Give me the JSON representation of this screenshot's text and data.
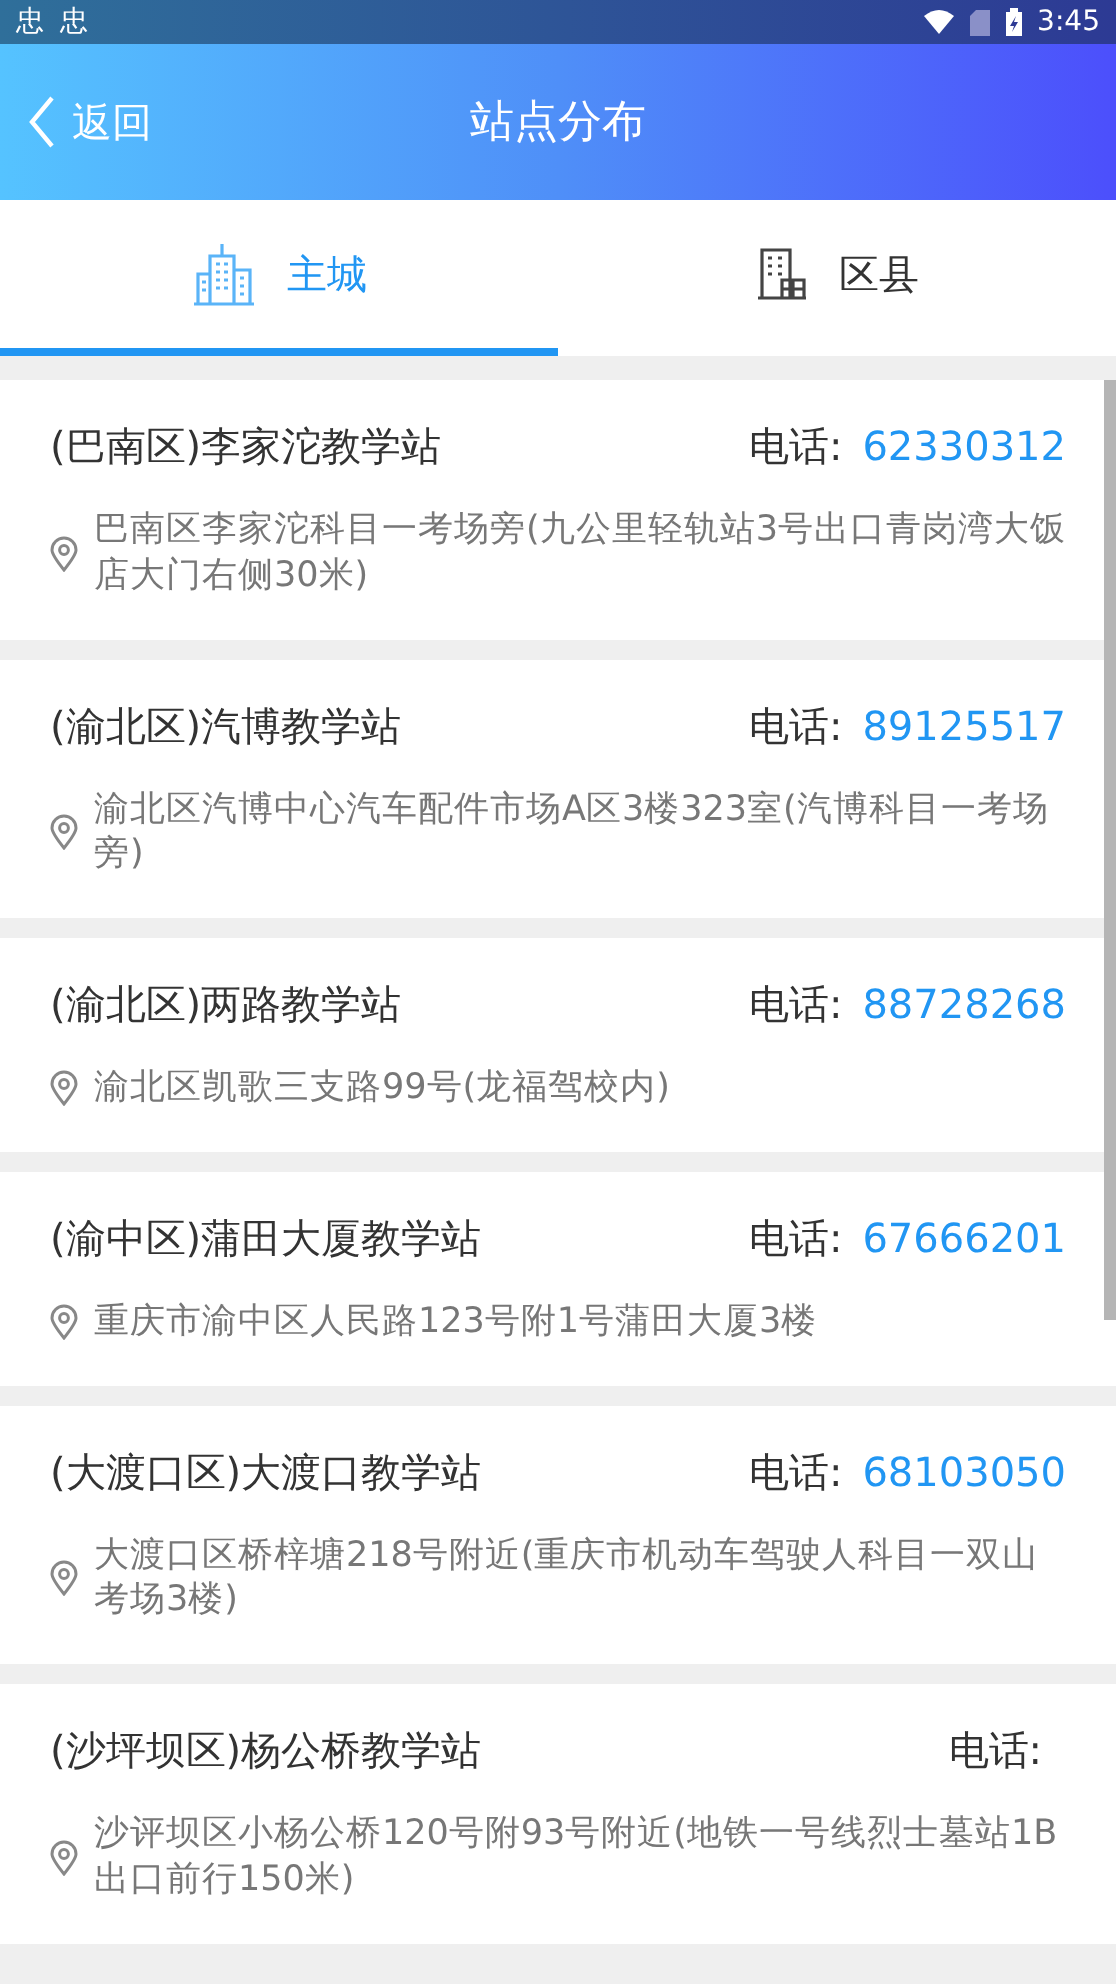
{
  "status_bar": {
    "notifications": [
      "忠",
      "忠"
    ],
    "time": "3:45"
  },
  "header": {
    "back": "返回",
    "title": "站点分布"
  },
  "tabs": [
    {
      "label": "主城",
      "kind": "city",
      "selected": true
    },
    {
      "label": "区县",
      "kind": "county",
      "selected": false
    }
  ],
  "stations": [
    {
      "name": "(巴南区)李家沱教学站",
      "phone_label": "电话:",
      "phone": "62330312",
      "address": "巴南区李家沱科目一考场旁(九公里轻轨站3号出口青岗湾大饭店大门右侧30米)"
    },
    {
      "name": "(渝北区)汽博教学站",
      "phone_label": "电话:",
      "phone": "89125517",
      "address": "渝北区汽博中心汽车配件市场A区3楼323室(汽博科目一考场旁)"
    },
    {
      "name": "(渝北区)两路教学站",
      "phone_label": "电话:",
      "phone": "88728268",
      "address": "渝北区凯歌三支路99号(龙福驾校内)"
    },
    {
      "name": "(渝中区)蒲田大厦教学站",
      "phone_label": "电话:",
      "phone": "67666201",
      "address": "重庆市渝中区人民路123号附1号蒲田大厦3楼"
    },
    {
      "name": "(大渡口区)大渡口教学站",
      "phone_label": "电话:",
      "phone": "68103050",
      "address": "大渡口区桥梓塘218号附近(重庆市机动车驾驶人科目一双山考场3楼)"
    },
    {
      "name": "(沙坪坝区)杨公桥教学站",
      "phone_label": "电话:",
      "address": "沙评坝区小杨公桥120号附93号附近(地铁一号线烈士墓站1B出口前行150米)"
    }
  ]
}
